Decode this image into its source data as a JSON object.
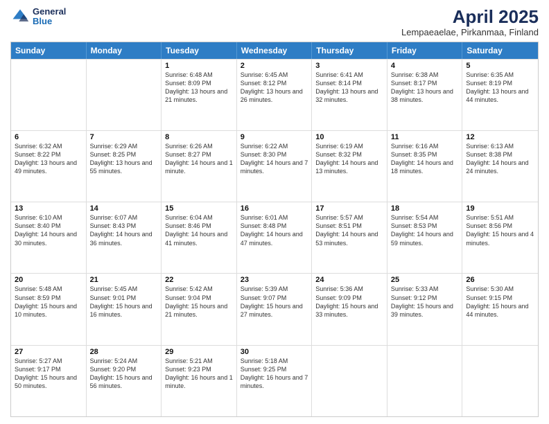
{
  "header": {
    "logo": {
      "general": "General",
      "blue": "Blue"
    },
    "title": "April 2025",
    "subtitle": "Lempaeaelae, Pirkanmaa, Finland"
  },
  "days_of_week": [
    "Sunday",
    "Monday",
    "Tuesday",
    "Wednesday",
    "Thursday",
    "Friday",
    "Saturday"
  ],
  "weeks": [
    [
      {
        "day": "",
        "sunrise": "",
        "sunset": "",
        "daylight": ""
      },
      {
        "day": "",
        "sunrise": "",
        "sunset": "",
        "daylight": ""
      },
      {
        "day": "1",
        "sunrise": "Sunrise: 6:48 AM",
        "sunset": "Sunset: 8:09 PM",
        "daylight": "Daylight: 13 hours and 21 minutes."
      },
      {
        "day": "2",
        "sunrise": "Sunrise: 6:45 AM",
        "sunset": "Sunset: 8:12 PM",
        "daylight": "Daylight: 13 hours and 26 minutes."
      },
      {
        "day": "3",
        "sunrise": "Sunrise: 6:41 AM",
        "sunset": "Sunset: 8:14 PM",
        "daylight": "Daylight: 13 hours and 32 minutes."
      },
      {
        "day": "4",
        "sunrise": "Sunrise: 6:38 AM",
        "sunset": "Sunset: 8:17 PM",
        "daylight": "Daylight: 13 hours and 38 minutes."
      },
      {
        "day": "5",
        "sunrise": "Sunrise: 6:35 AM",
        "sunset": "Sunset: 8:19 PM",
        "daylight": "Daylight: 13 hours and 44 minutes."
      }
    ],
    [
      {
        "day": "6",
        "sunrise": "Sunrise: 6:32 AM",
        "sunset": "Sunset: 8:22 PM",
        "daylight": "Daylight: 13 hours and 49 minutes."
      },
      {
        "day": "7",
        "sunrise": "Sunrise: 6:29 AM",
        "sunset": "Sunset: 8:25 PM",
        "daylight": "Daylight: 13 hours and 55 minutes."
      },
      {
        "day": "8",
        "sunrise": "Sunrise: 6:26 AM",
        "sunset": "Sunset: 8:27 PM",
        "daylight": "Daylight: 14 hours and 1 minute."
      },
      {
        "day": "9",
        "sunrise": "Sunrise: 6:22 AM",
        "sunset": "Sunset: 8:30 PM",
        "daylight": "Daylight: 14 hours and 7 minutes."
      },
      {
        "day": "10",
        "sunrise": "Sunrise: 6:19 AM",
        "sunset": "Sunset: 8:32 PM",
        "daylight": "Daylight: 14 hours and 13 minutes."
      },
      {
        "day": "11",
        "sunrise": "Sunrise: 6:16 AM",
        "sunset": "Sunset: 8:35 PM",
        "daylight": "Daylight: 14 hours and 18 minutes."
      },
      {
        "day": "12",
        "sunrise": "Sunrise: 6:13 AM",
        "sunset": "Sunset: 8:38 PM",
        "daylight": "Daylight: 14 hours and 24 minutes."
      }
    ],
    [
      {
        "day": "13",
        "sunrise": "Sunrise: 6:10 AM",
        "sunset": "Sunset: 8:40 PM",
        "daylight": "Daylight: 14 hours and 30 minutes."
      },
      {
        "day": "14",
        "sunrise": "Sunrise: 6:07 AM",
        "sunset": "Sunset: 8:43 PM",
        "daylight": "Daylight: 14 hours and 36 minutes."
      },
      {
        "day": "15",
        "sunrise": "Sunrise: 6:04 AM",
        "sunset": "Sunset: 8:46 PM",
        "daylight": "Daylight: 14 hours and 41 minutes."
      },
      {
        "day": "16",
        "sunrise": "Sunrise: 6:01 AM",
        "sunset": "Sunset: 8:48 PM",
        "daylight": "Daylight: 14 hours and 47 minutes."
      },
      {
        "day": "17",
        "sunrise": "Sunrise: 5:57 AM",
        "sunset": "Sunset: 8:51 PM",
        "daylight": "Daylight: 14 hours and 53 minutes."
      },
      {
        "day": "18",
        "sunrise": "Sunrise: 5:54 AM",
        "sunset": "Sunset: 8:53 PM",
        "daylight": "Daylight: 14 hours and 59 minutes."
      },
      {
        "day": "19",
        "sunrise": "Sunrise: 5:51 AM",
        "sunset": "Sunset: 8:56 PM",
        "daylight": "Daylight: 15 hours and 4 minutes."
      }
    ],
    [
      {
        "day": "20",
        "sunrise": "Sunrise: 5:48 AM",
        "sunset": "Sunset: 8:59 PM",
        "daylight": "Daylight: 15 hours and 10 minutes."
      },
      {
        "day": "21",
        "sunrise": "Sunrise: 5:45 AM",
        "sunset": "Sunset: 9:01 PM",
        "daylight": "Daylight: 15 hours and 16 minutes."
      },
      {
        "day": "22",
        "sunrise": "Sunrise: 5:42 AM",
        "sunset": "Sunset: 9:04 PM",
        "daylight": "Daylight: 15 hours and 21 minutes."
      },
      {
        "day": "23",
        "sunrise": "Sunrise: 5:39 AM",
        "sunset": "Sunset: 9:07 PM",
        "daylight": "Daylight: 15 hours and 27 minutes."
      },
      {
        "day": "24",
        "sunrise": "Sunrise: 5:36 AM",
        "sunset": "Sunset: 9:09 PM",
        "daylight": "Daylight: 15 hours and 33 minutes."
      },
      {
        "day": "25",
        "sunrise": "Sunrise: 5:33 AM",
        "sunset": "Sunset: 9:12 PM",
        "daylight": "Daylight: 15 hours and 39 minutes."
      },
      {
        "day": "26",
        "sunrise": "Sunrise: 5:30 AM",
        "sunset": "Sunset: 9:15 PM",
        "daylight": "Daylight: 15 hours and 44 minutes."
      }
    ],
    [
      {
        "day": "27",
        "sunrise": "Sunrise: 5:27 AM",
        "sunset": "Sunset: 9:17 PM",
        "daylight": "Daylight: 15 hours and 50 minutes."
      },
      {
        "day": "28",
        "sunrise": "Sunrise: 5:24 AM",
        "sunset": "Sunset: 9:20 PM",
        "daylight": "Daylight: 15 hours and 56 minutes."
      },
      {
        "day": "29",
        "sunrise": "Sunrise: 5:21 AM",
        "sunset": "Sunset: 9:23 PM",
        "daylight": "Daylight: 16 hours and 1 minute."
      },
      {
        "day": "30",
        "sunrise": "Sunrise: 5:18 AM",
        "sunset": "Sunset: 9:25 PM",
        "daylight": "Daylight: 16 hours and 7 minutes."
      },
      {
        "day": "",
        "sunrise": "",
        "sunset": "",
        "daylight": ""
      },
      {
        "day": "",
        "sunrise": "",
        "sunset": "",
        "daylight": ""
      },
      {
        "day": "",
        "sunrise": "",
        "sunset": "",
        "daylight": ""
      }
    ]
  ]
}
